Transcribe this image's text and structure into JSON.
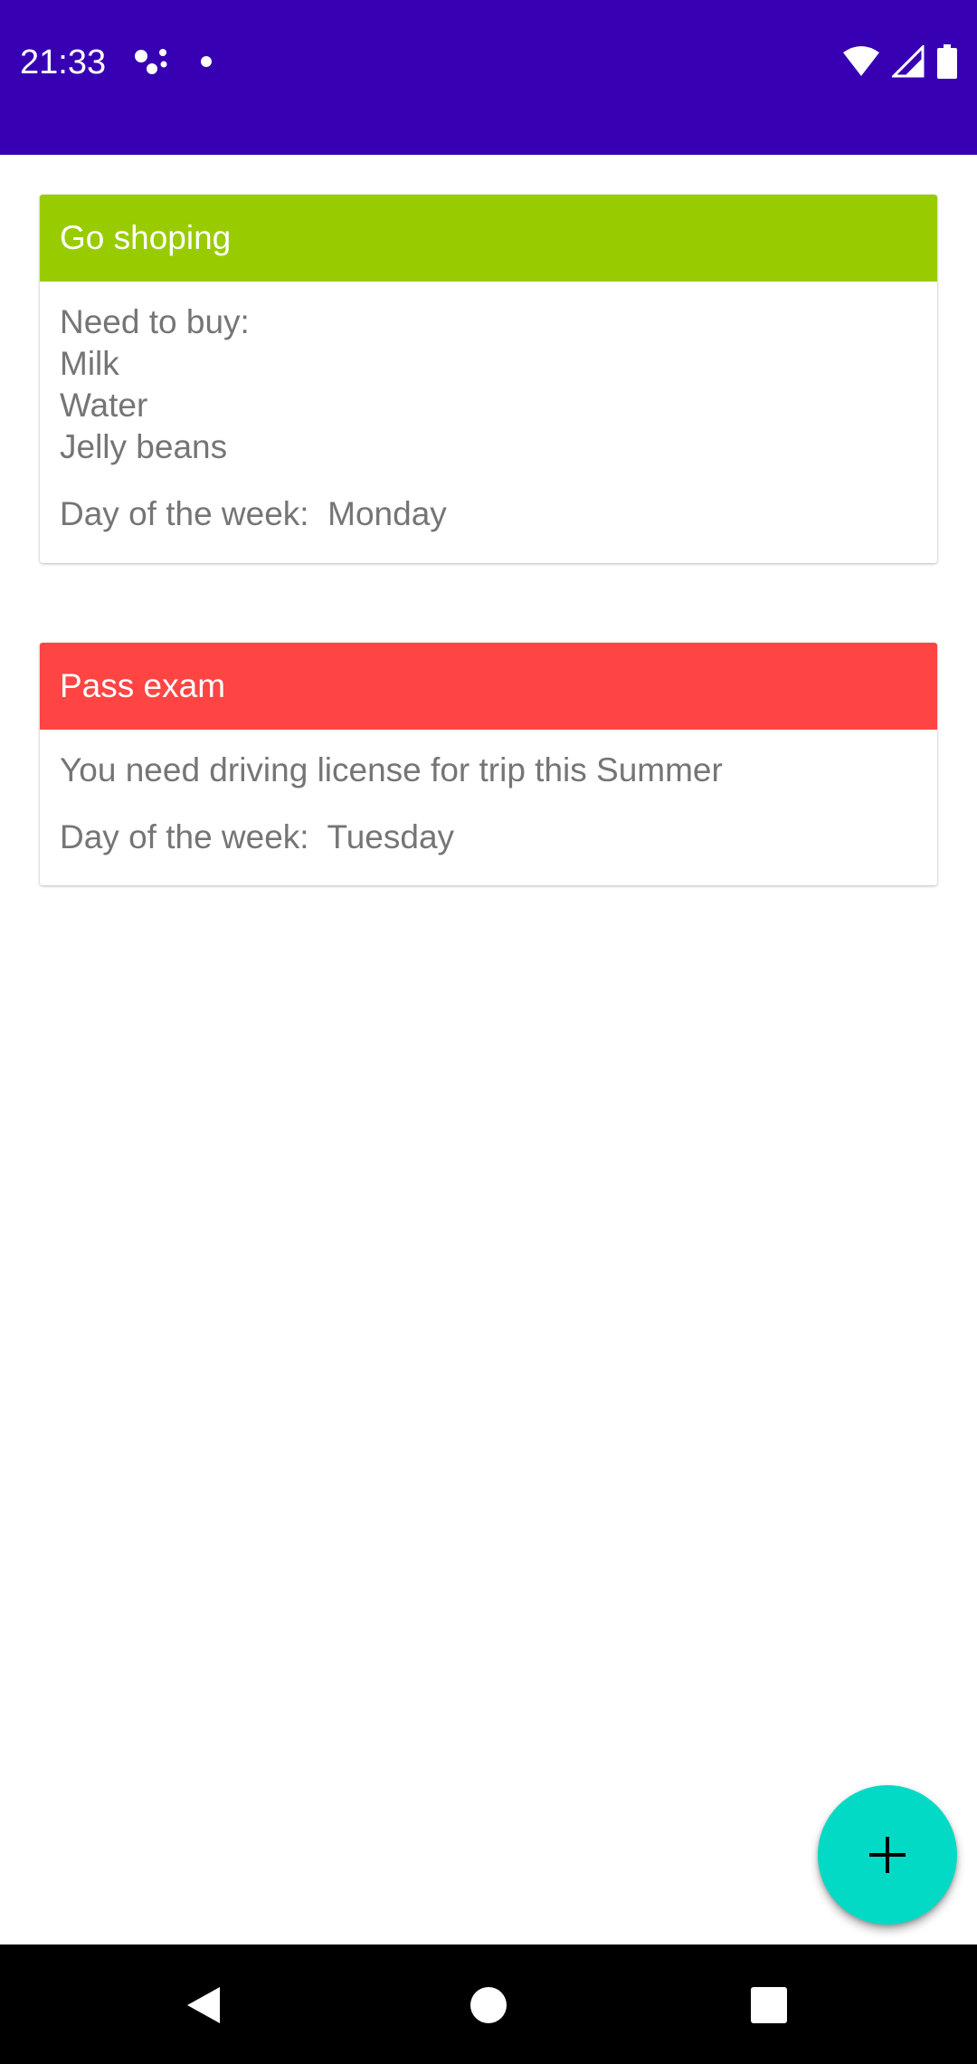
{
  "status_bar": {
    "time": "21:33",
    "background_color": "#3700b3",
    "left_icons": [
      "assistant-dots-icon",
      "notification-dot-icon"
    ],
    "right_icons": [
      "wifi-icon",
      "cellular-signal-icon",
      "battery-icon"
    ]
  },
  "cards": [
    {
      "title": "Go shoping",
      "header_color": "#99cc00",
      "description": "Need to buy:\nMilk\nWater\nJelly beans",
      "day_label": "Day of the week:",
      "day_value": "Monday"
    },
    {
      "title": "Pass exam",
      "header_color": "#ff4444",
      "description": "You need driving license for trip this Summer",
      "day_label": "Day of the week:",
      "day_value": "Tuesday"
    }
  ],
  "fab": {
    "icon": "plus-icon",
    "color": "#03dac5"
  },
  "nav_bar": {
    "buttons": [
      "back-icon",
      "home-icon",
      "recents-icon"
    ]
  }
}
